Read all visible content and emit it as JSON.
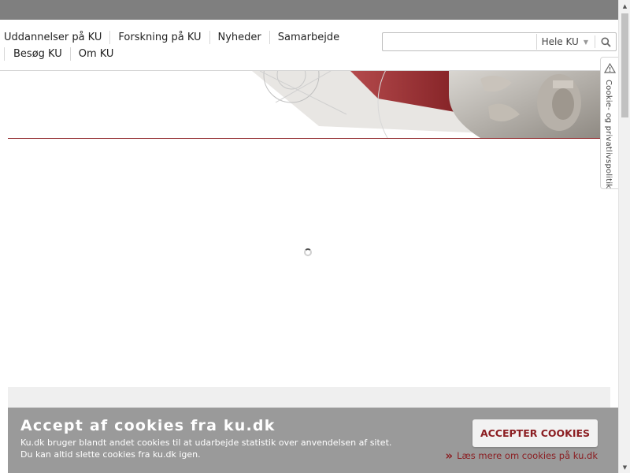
{
  "nav": {
    "row1": [
      "Uddannelser på KU",
      "Forskning på KU",
      "Nyheder",
      "Samarbejde"
    ],
    "row2": [
      "Besøg KU",
      "Om KU"
    ]
  },
  "search": {
    "value": "",
    "scope": "Hele KU",
    "icon": "search-icon"
  },
  "cookie_tab": {
    "label": "Cookie- og privatlivspolitik",
    "icon": "warning-icon"
  },
  "cookie_banner": {
    "title": "Accept af cookies fra ku.dk",
    "line1": "Ku.dk bruger blandt andet cookies til at udarbejde statistik over anvendelsen af sitet.",
    "line2": "Du kan altid slette cookies fra ku.dk igen.",
    "accept_label": "ACCEPTER COOKIES",
    "more_label": "Læs mere om cookies på ku.dk"
  },
  "colors": {
    "brand": "#8b1e22",
    "topbar": "#7f7f7f",
    "cookie_bg": "#9a9a9a"
  }
}
